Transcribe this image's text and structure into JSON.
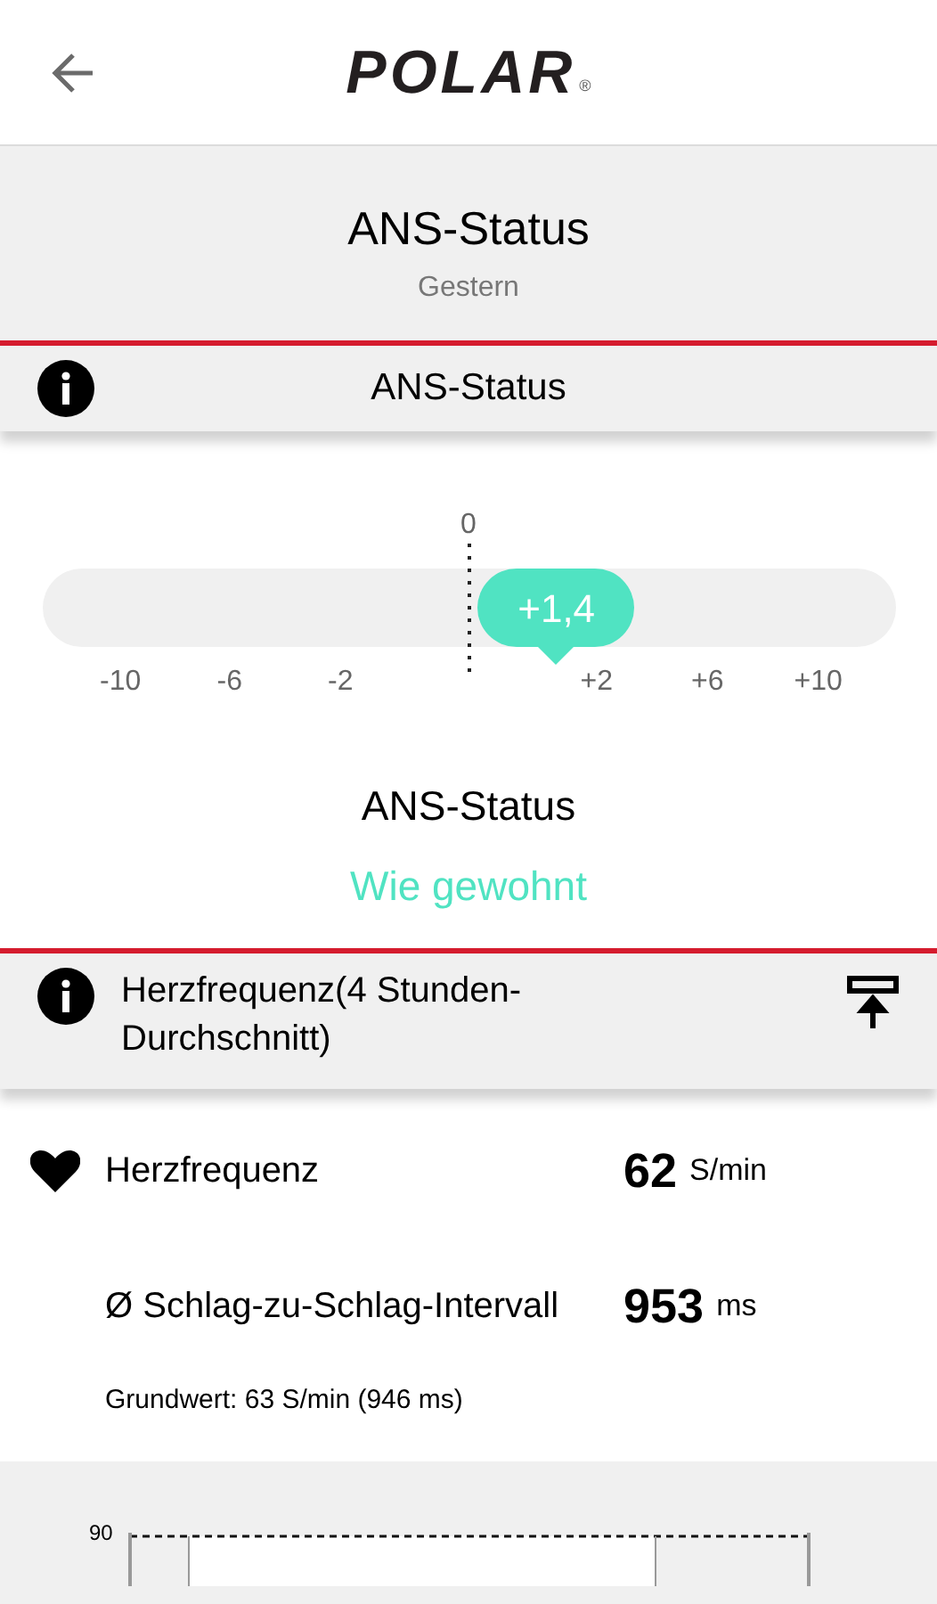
{
  "header": {
    "logo": "POLAR",
    "registered": "®"
  },
  "title": {
    "heading": "ANS-Status",
    "date": "Gestern"
  },
  "ans_section": {
    "label": "ANS-Status"
  },
  "ans_scale": {
    "zero_label": "0",
    "reading": "+1,4",
    "level": 0.603,
    "ticks": [
      "-10",
      "-6",
      "-2",
      "+2",
      "+6",
      "+10"
    ]
  },
  "ans_result": {
    "label": "ANS-Status",
    "status": "Wie gewohnt"
  },
  "hr_section": {
    "label": "Herzfrequenz(4 Stunden-Durchschnitt)"
  },
  "metrics": [
    {
      "kind": "heart",
      "label": "Herzfrequenz",
      "value": "62",
      "unit": "S/min"
    },
    {
      "kind": "plain",
      "label": "Ø Schlag-zu-Schlag-Intervall",
      "value": "953",
      "unit": "ms"
    }
  ],
  "baseline": "Grundwert: 63 S/min (946 ms)",
  "chart": {
    "y_tick": "90"
  }
}
